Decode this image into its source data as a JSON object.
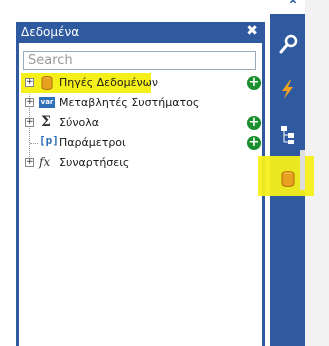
{
  "panel": {
    "title": "Δεδομένα",
    "close_glyph": "✖",
    "search": {
      "placeholder": "Search",
      "value": ""
    },
    "tree": [
      {
        "label": "Πηγές Δεδομένων",
        "icon": "database-icon",
        "expandable": true,
        "has_add": true,
        "highlighted": true
      },
      {
        "label": "Μεταβλητές Συστήματος",
        "icon": "var-icon",
        "badge": "var",
        "expandable": true,
        "has_add": false,
        "highlighted": false
      },
      {
        "label": "Σύνολα",
        "icon": "sigma-icon",
        "glyph": "Σ",
        "expandable": true,
        "has_add": true,
        "highlighted": false
      },
      {
        "label": "Παράμετροι",
        "icon": "parameters-icon",
        "glyph": "[p]",
        "expandable": false,
        "has_add": true,
        "highlighted": false
      },
      {
        "label": "Συναρτήσεις",
        "icon": "function-icon",
        "glyph": "fx",
        "expandable": true,
        "has_add": false,
        "highlighted": false
      }
    ]
  },
  "toolbar": {
    "buttons": [
      {
        "name": "wrench-icon"
      },
      {
        "name": "lightning-icon"
      },
      {
        "name": "tree-structure-icon"
      },
      {
        "name": "database-icon",
        "highlighted": true
      }
    ]
  },
  "colors": {
    "panel_blue": "#2f5aa0",
    "highlight_yellow": "#f6f01a",
    "add_green": "#1a8f2e",
    "database_orange": "#e8a020"
  }
}
